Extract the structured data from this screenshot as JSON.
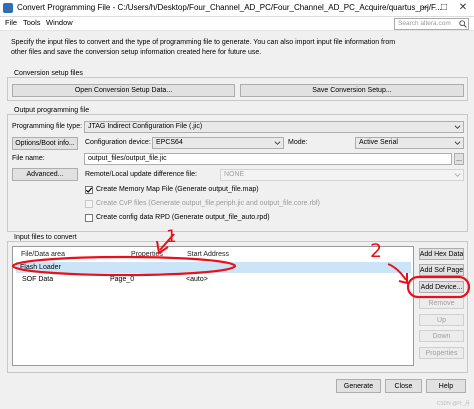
{
  "window": {
    "title": "Convert Programming File - C:/Users/h/Desktop/Four_Channel_AD_PC/Four_Channel_AD_PC_Acquire/quartus_prj/F..."
  },
  "menu": {
    "items": [
      "File",
      "Tools",
      "Window"
    ]
  },
  "search": {
    "placeholder": "Search altera.com"
  },
  "intro": {
    "text": "Specify the input files to convert and the type of programming file to generate. You can also import input file information from other files and save the conversion setup information created here for future use."
  },
  "conversion_setup": {
    "label": "Conversion setup files",
    "open_button": "Open Conversion Setup Data...",
    "save_button": "Save Conversion Setup..."
  },
  "output": {
    "label": "Output programming file",
    "type_label": "Programming file type:",
    "type_value": "JTAG Indirect Configuration File (.jic)",
    "options_button": "Options/Boot info...",
    "config_device_label": "Configuration device:",
    "config_device_value": "EPCS64",
    "mode_label": "Mode:",
    "mode_value": "Active Serial",
    "file_name_label": "File name:",
    "file_name_value": "output_files/output_file.jic",
    "browse_button": "...",
    "advanced_button": "Advanced...",
    "remote_label": "Remote/Local update difference file:",
    "remote_value": "NONE",
    "memory_map_label": "Create Memory Map File (Generate output_file.map)",
    "cvp_label": "Create CvP files (Generate output_file.periph.jic and output_file.core.rbf)",
    "config_rpd_label": "Create config data RPD (Generate output_file_auto.rpd)"
  },
  "input": {
    "label": "Input files to convert",
    "columns": [
      "File/Data area",
      "Properties",
      "Start Address"
    ],
    "rows": [
      {
        "file": "Flash Loader",
        "properties": "",
        "start": ""
      },
      {
        "file": "SOF Data",
        "properties": "Page_0",
        "start": "<auto>"
      }
    ],
    "buttons": {
      "add_hex": "Add Hex Data",
      "add_sof": "Add Sof Page",
      "add_device": "Add Device...",
      "remove": "Remove",
      "up": "Up",
      "down": "Down",
      "properties": "Properties"
    }
  },
  "footer": {
    "generate": "Generate",
    "close": "Close",
    "help": "Help"
  },
  "annotations": {
    "mark1": "1",
    "mark2": "2"
  },
  "watermark": "CSDN @叶_月",
  "colors": {
    "annotation_red": "#e8101a",
    "selection": "#cce4f7"
  }
}
